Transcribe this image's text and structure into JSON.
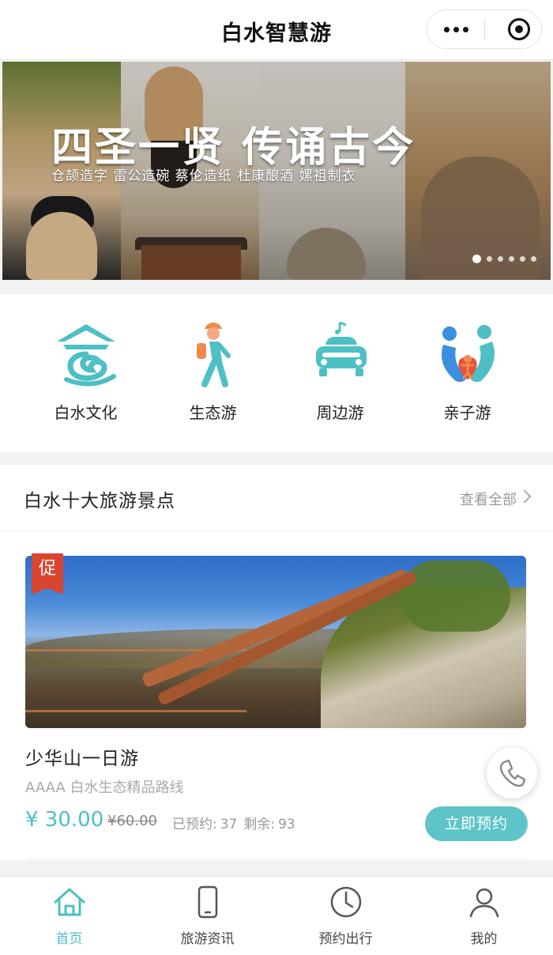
{
  "header": {
    "title": "白水智慧游"
  },
  "banner": {
    "headline": "四圣一贤 传诵古今",
    "subtitle": "仓颉造字  雷公造碗  蔡伦造纸  杜康酿酒  嫘祖制衣",
    "slide_count": 6,
    "active_slide": 1
  },
  "categories": [
    {
      "label": "白水文化",
      "icon": "temple-icon"
    },
    {
      "label": "生态游",
      "icon": "hiker-icon"
    },
    {
      "label": "周边游",
      "icon": "car-icon"
    },
    {
      "label": "亲子游",
      "icon": "family-icon"
    }
  ],
  "section": {
    "title": "白水十大旅游景点",
    "view_all": "查看全部"
  },
  "card": {
    "promo_badge": "促",
    "title": "少华山一日游",
    "subtitle": "AAAA 白水生态精品路线",
    "price": "¥ 30.00",
    "old_price": "¥60.00",
    "booked_label": "已预约:",
    "booked_value": "37",
    "remaining_label": "剩余:",
    "remaining_value": "93",
    "book_button": "立即预约"
  },
  "tabbar": [
    {
      "label": "首页",
      "icon": "home-icon",
      "active": true
    },
    {
      "label": "旅游资讯",
      "icon": "phone-icon",
      "active": false
    },
    {
      "label": "预约出行",
      "icon": "clock-icon",
      "active": false
    },
    {
      "label": "我的",
      "icon": "user-icon",
      "active": false
    }
  ],
  "colors": {
    "accent": "#4dbfc5",
    "promo": "#d9452f",
    "button": "#5ec4c8"
  }
}
